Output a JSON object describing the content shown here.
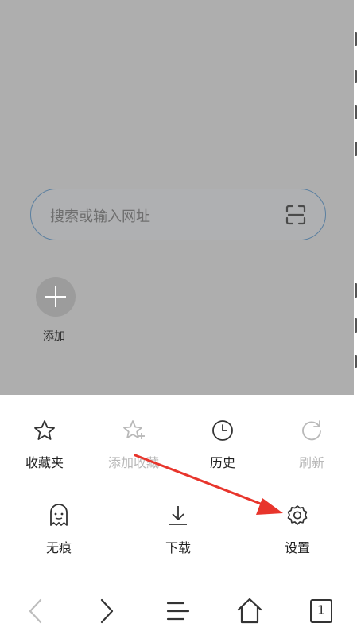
{
  "search": {
    "placeholder": "搜索或输入网址"
  },
  "shortcut": {
    "add_label": "添加"
  },
  "menu": {
    "favorites": "收藏夹",
    "add_favorite": "添加收藏",
    "history": "历史",
    "refresh": "刷新",
    "incognito": "无痕",
    "download": "下载",
    "settings": "设置"
  },
  "nav": {
    "tabs_count": "1"
  },
  "colors": {
    "overlay": "#aeaeae",
    "accent": "#e8352c"
  }
}
